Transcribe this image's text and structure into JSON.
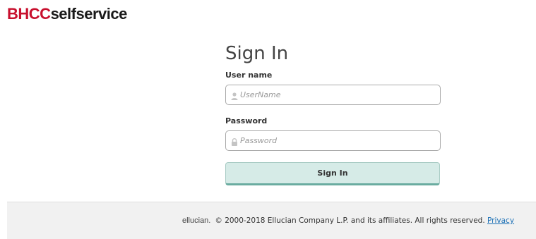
{
  "header": {
    "logo_brand": "BHCC",
    "logo_suffix": "selfservice"
  },
  "login": {
    "title": "Sign In",
    "username_label": "User name",
    "username_placeholder": "UserName",
    "username_icon": "user-icon",
    "password_label": "Password",
    "password_placeholder": "Password",
    "password_icon": "lock-icon",
    "submit_label": "Sign In"
  },
  "footer": {
    "vendor_logo": "ellucian.",
    "copyright": "© 2000-2018 Ellucian Company L.P. and its affiliates. All rights reserved.",
    "privacy_link": "Privacy"
  },
  "colors": {
    "brand_red": "#c8102e",
    "button_bg": "#d6ebe7",
    "button_accent": "#6aaca0",
    "link": "#1a6fb5",
    "footer_bg": "#f1f1f1"
  }
}
